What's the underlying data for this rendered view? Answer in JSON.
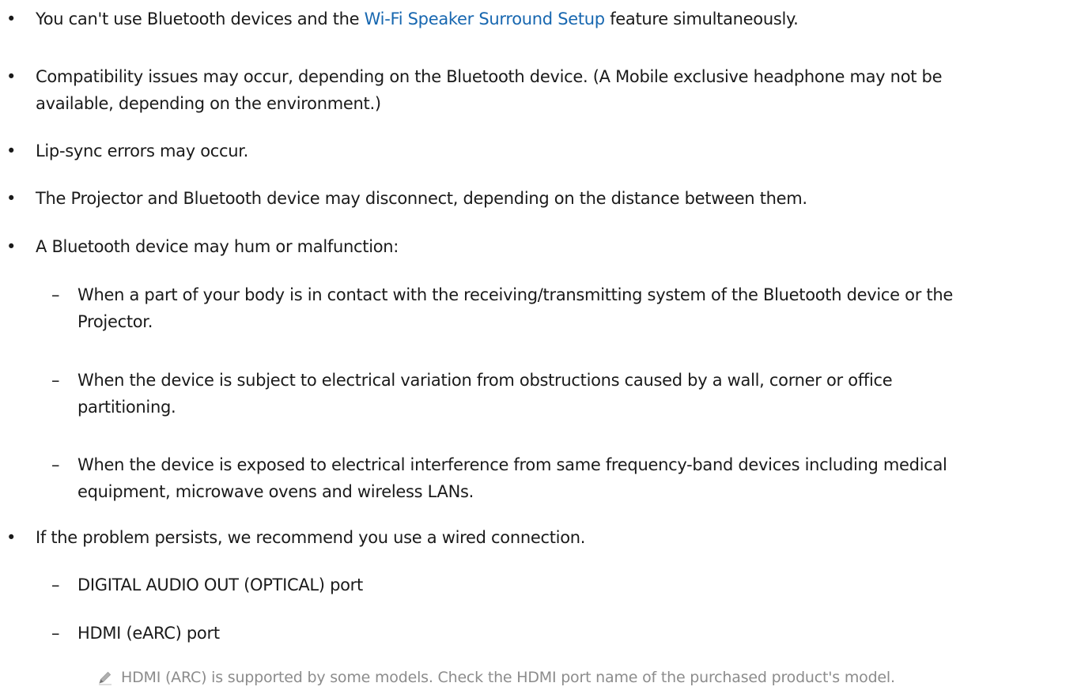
{
  "list": {
    "bullet_marker": "•",
    "dash_marker": "–",
    "items": [
      {
        "before": "You can't use Bluetooth devices and the ",
        "link": "Wi-Fi Speaker Surround Setup",
        "after": " feature simultaneously."
      },
      {
        "line1": "Compatibility issues may occur, depending on the Bluetooth device. (A Mobile exclusive headphone may not be",
        "line2": "available, depending on the environment.)"
      },
      {
        "text": "Lip-sync errors may occur."
      },
      {
        "text": "The Projector and Bluetooth device may disconnect, depending on the distance between them."
      },
      {
        "text": "A Bluetooth device may hum or malfunction:",
        "subitems": [
          {
            "line1": "When a part of your body is in contact with the receiving/transmitting system of the Bluetooth device or the",
            "line2": "Projector."
          },
          {
            "line1": "When the device is subject to electrical variation from obstructions caused by a wall, corner or office",
            "line2": "partitioning."
          },
          {
            "line1": "When the device is exposed to electrical interference from same frequency-band devices including medical",
            "line2": "equipment, microwave ovens and wireless LANs."
          }
        ]
      },
      {
        "text": "If the problem persists, we recommend you use a wired connection.",
        "subitems": [
          {
            "text": "DIGITAL AUDIO OUT (OPTICAL) port"
          },
          {
            "text": "HDMI (eARC) port"
          }
        ],
        "note": "HDMI (ARC) is supported by some models. Check the HDMI port name of the purchased product's model."
      }
    ]
  },
  "colors": {
    "text": "#1a1a1a",
    "link": "#1767b0",
    "note": "#8c8c8c"
  },
  "icons": {
    "note_icon": "pencil-icon"
  }
}
